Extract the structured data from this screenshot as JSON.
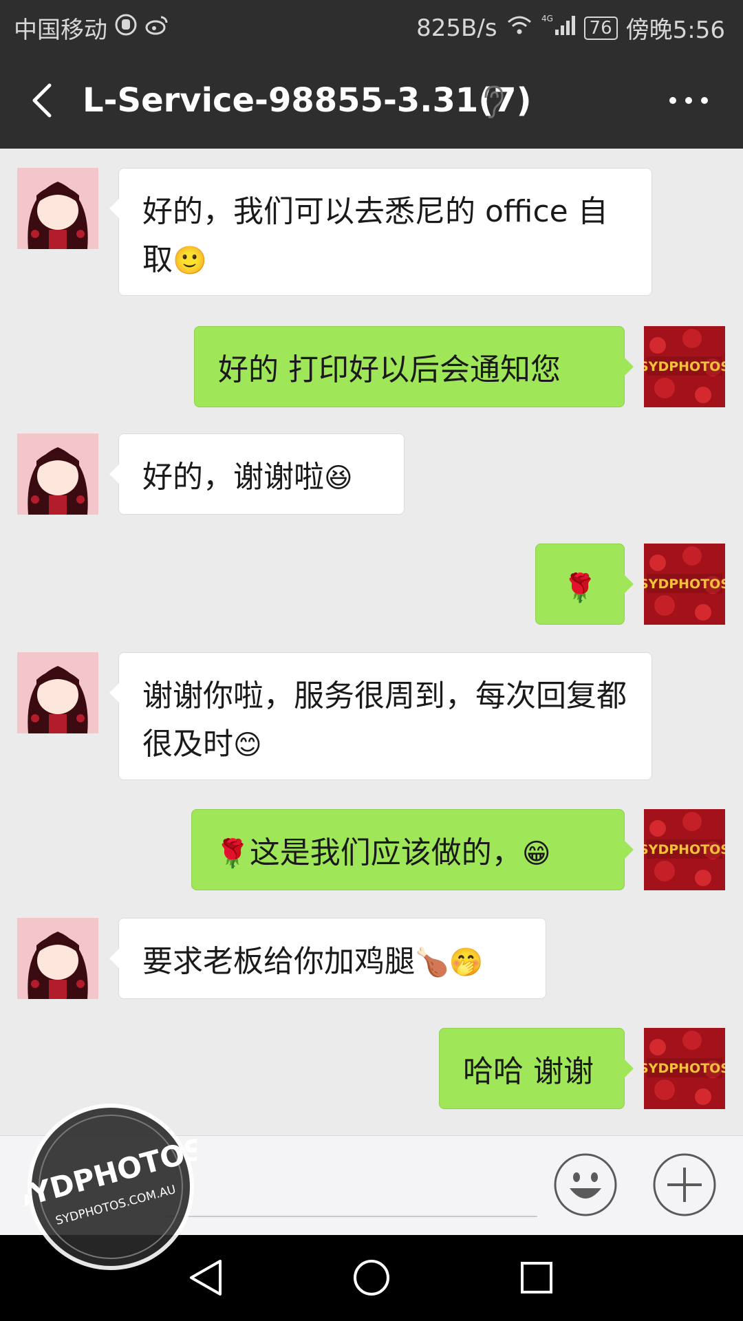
{
  "status_bar": {
    "carrier": "中国移动",
    "speed": "825B/s",
    "network": "4G",
    "battery": "76",
    "time": "傍晚5:56"
  },
  "header": {
    "title": "L-Service-98855-3.31(7)"
  },
  "messages": [
    {
      "side": "in",
      "text": "好的，我们可以去悉尼的 office 自取",
      "emoji": "🙂"
    },
    {
      "side": "out",
      "text": "好的  打印好以后会通知您",
      "emoji": ""
    },
    {
      "side": "in",
      "text": "好的，谢谢啦",
      "emoji": "😆"
    },
    {
      "side": "out",
      "text": "",
      "emoji": "🌹"
    },
    {
      "side": "in",
      "text": "谢谢你啦，服务很周到，每次回复都很及时",
      "emoji": "😊"
    },
    {
      "side": "out",
      "text": "这是我们应该做的，",
      "emoji": "😁",
      "lead_emoji": "🌹"
    },
    {
      "side": "in",
      "text": "要求老板给你加鸡腿",
      "emoji": "🍗🤭"
    },
    {
      "side": "out",
      "text": "哈哈 谢谢",
      "emoji": ""
    }
  ],
  "avatar_text": "SYDPHOTOS",
  "watermark": {
    "brand": "SYDPHOTOS",
    "url": "SYDPHOTOS.COM.AU"
  },
  "icons": {
    "back": "chevron-left-icon",
    "ear": "ear-icon",
    "more": "more-icon",
    "emoji_button": "smiley-icon",
    "plus_button": "plus-icon"
  },
  "colors": {
    "header_bg": "#2e2e2e",
    "chat_bg": "#ebebeb",
    "outgoing_bubble": "#9fe658",
    "incoming_bubble": "#ffffff"
  }
}
